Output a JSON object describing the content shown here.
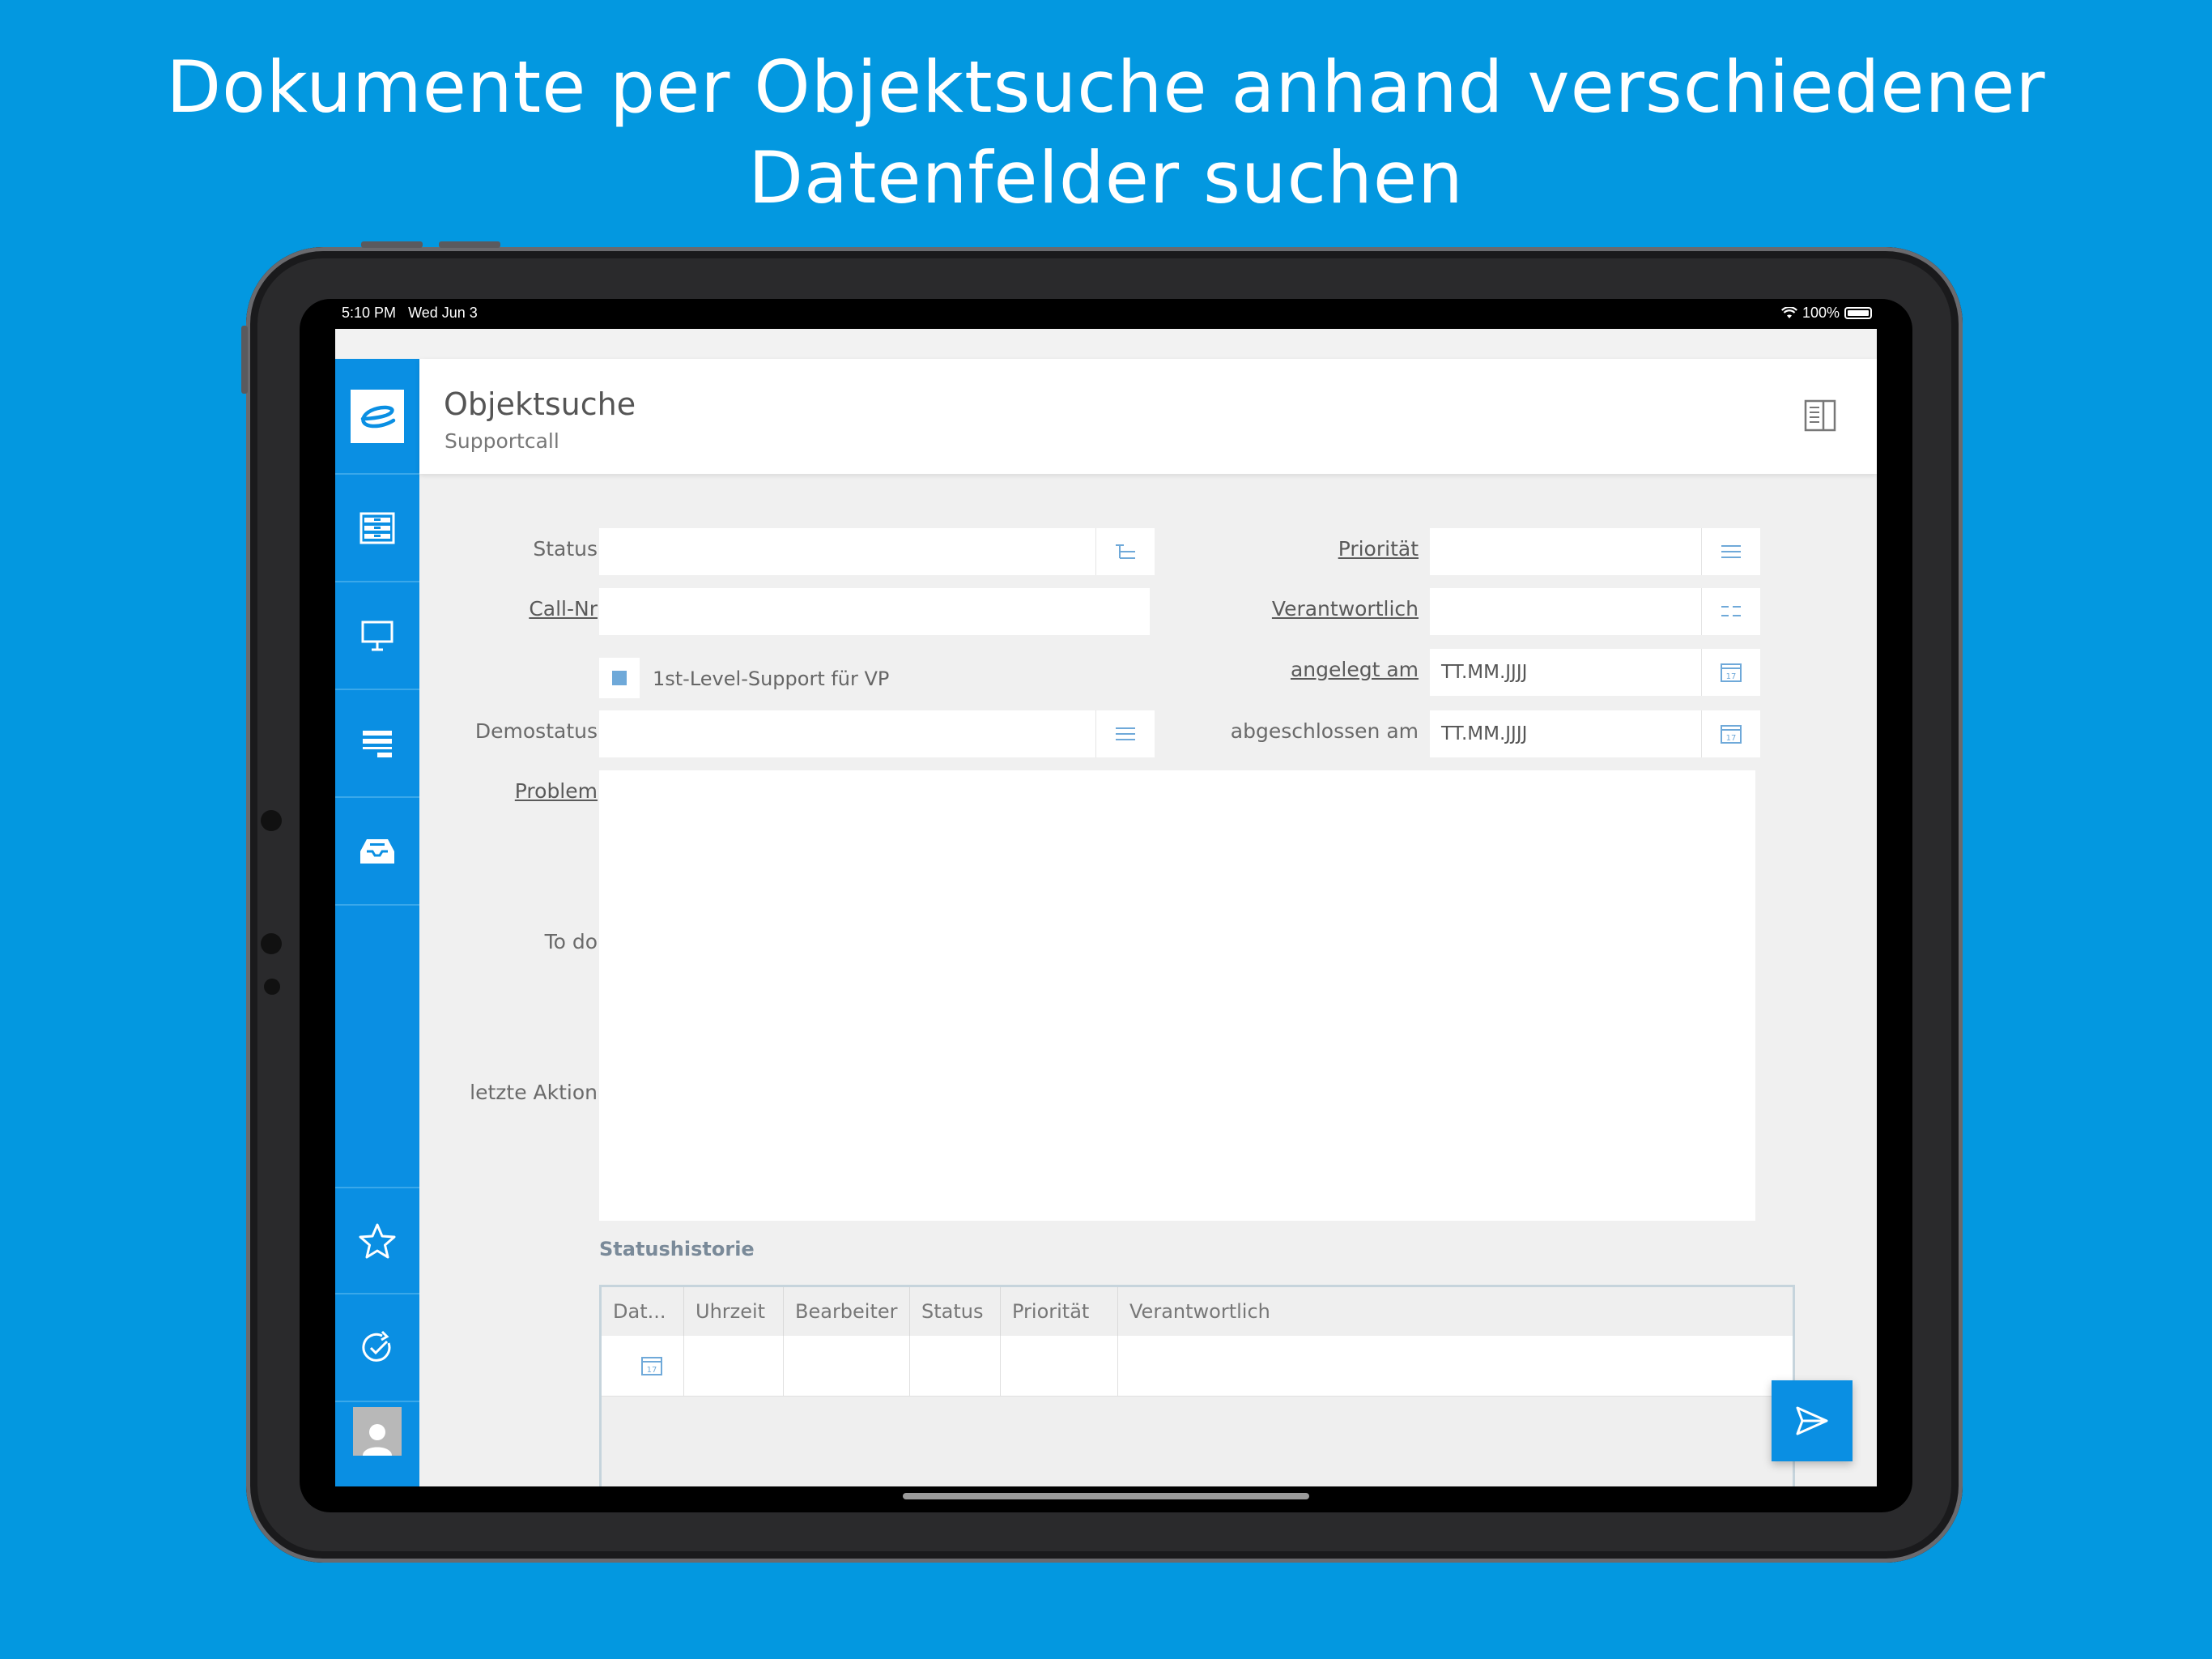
{
  "headline": {
    "line1": "Dokumente per Objektsuche anhand verschiedener",
    "line2": "Datenfelder suchen"
  },
  "statusbar": {
    "time": "5:10 PM",
    "date": "Wed Jun 3",
    "battery": "100%",
    "icons": [
      "wifi-icon",
      "battery-icon"
    ]
  },
  "sidebar": {
    "logo": "e",
    "items": [
      {
        "name": "archive-icon"
      },
      {
        "name": "presentation-icon"
      },
      {
        "name": "list-icon"
      },
      {
        "name": "inbox-icon"
      },
      {
        "name": "star-icon"
      },
      {
        "name": "sync-icon"
      },
      {
        "name": "user-icon"
      }
    ]
  },
  "header": {
    "title": "Objektsuche",
    "subtitle": "Supportcall"
  },
  "form": {
    "status_label": "Status",
    "callnr_label": "Call-Nr",
    "checkbox_label": "1st-Level-Support für VP",
    "demostatus_label": "Demostatus",
    "prioritaet_label": "Priorität",
    "verantwortlich_label": "Verantwortlich",
    "angelegt_label": "angelegt am",
    "angelegt_placeholder": "TT.MM.JJJJ",
    "abgeschlossen_label": "abgeschlossen am",
    "abgeschlossen_placeholder": "TT.MM.JJJJ",
    "problem_label": "Problem",
    "todo_label": "To do",
    "letzte_aktion_label": "letzte Aktion"
  },
  "statushistorie": {
    "title": "Statushistorie",
    "columns": [
      "Dat...",
      "Uhrzeit",
      "Bearbeiter",
      "Status",
      "Priorität",
      "Verantwortlich"
    ]
  },
  "colors": {
    "background": "#0398e0",
    "accent": "#0a8fe3"
  }
}
